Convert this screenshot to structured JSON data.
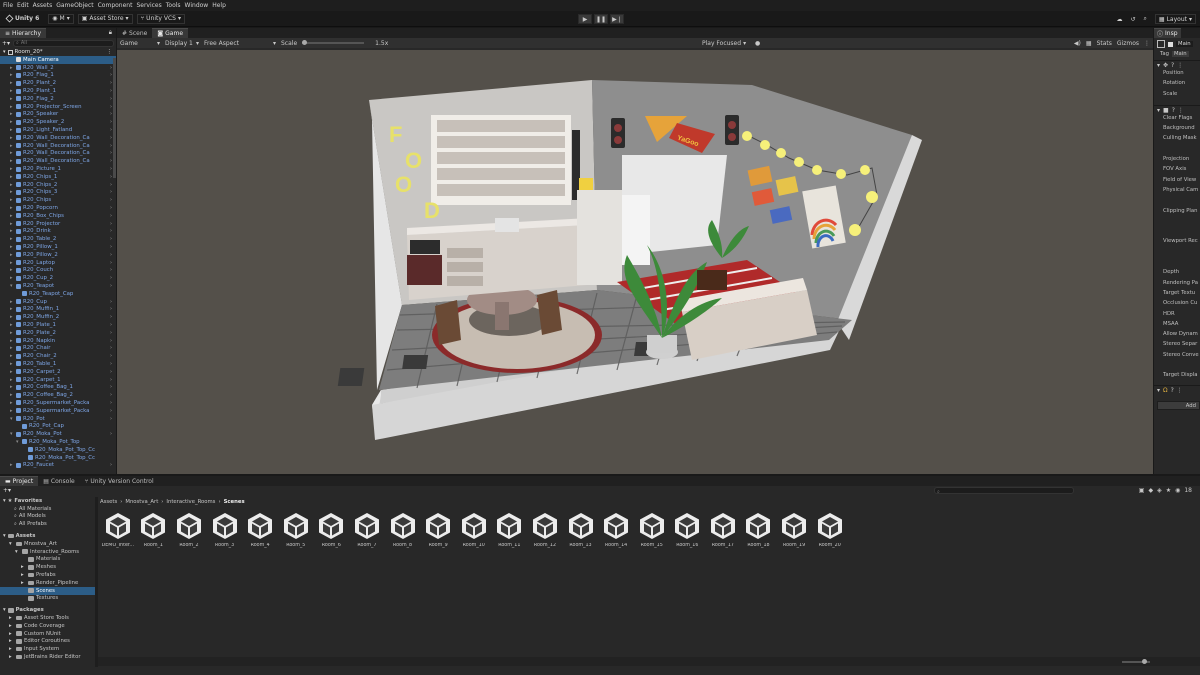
{
  "menubar": [
    "File",
    "Edit",
    "Assets",
    "GameObject",
    "Component",
    "Services",
    "Tools",
    "Window",
    "Help"
  ],
  "toolbar": {
    "unity_version": "Unity 6",
    "account": "M",
    "asset_store": "Asset Store",
    "vcs": "Unity VCS",
    "layout": "Layout"
  },
  "hierarchy": {
    "tab": "Hierarchy",
    "search_placeholder": "All",
    "scene": "Room_20*",
    "items": [
      {
        "label": "Main Camera",
        "indent": 1,
        "arrow": false,
        "selected": true
      },
      {
        "label": "R20_Wall_2",
        "indent": 1,
        "arrow": true
      },
      {
        "label": "R20_Flag_1",
        "indent": 1,
        "arrow": true
      },
      {
        "label": "R20_Plant_2",
        "indent": 1,
        "arrow": true
      },
      {
        "label": "R20_Plant_1",
        "indent": 1,
        "arrow": true
      },
      {
        "label": "R20_Flag_2",
        "indent": 1,
        "arrow": true
      },
      {
        "label": "R20_Projector_Screen",
        "indent": 1,
        "arrow": true
      },
      {
        "label": "R20_Speaker",
        "indent": 1,
        "arrow": true
      },
      {
        "label": "R20_Speaker_2",
        "indent": 1,
        "arrow": true
      },
      {
        "label": "R20_Light_Fatland",
        "indent": 1,
        "arrow": true
      },
      {
        "label": "R20_Wall_Decoration_Ca",
        "indent": 1,
        "arrow": true
      },
      {
        "label": "R20_Wall_Decoration_Ca",
        "indent": 1,
        "arrow": true
      },
      {
        "label": "R20_Wall_Decoration_Ca",
        "indent": 1,
        "arrow": true
      },
      {
        "label": "R20_Wall_Decoration_Ca",
        "indent": 1,
        "arrow": true
      },
      {
        "label": "R20_Picture_1",
        "indent": 1,
        "arrow": true
      },
      {
        "label": "R20_Chips_1",
        "indent": 1,
        "arrow": true
      },
      {
        "label": "R20_Chips_2",
        "indent": 1,
        "arrow": true
      },
      {
        "label": "R20_Chips_3",
        "indent": 1,
        "arrow": true
      },
      {
        "label": "R20_Chips",
        "indent": 1,
        "arrow": true
      },
      {
        "label": "R20_Popcorn",
        "indent": 1,
        "arrow": true
      },
      {
        "label": "R20_Box_Chips",
        "indent": 1,
        "arrow": true
      },
      {
        "label": "R20_Projector",
        "indent": 1,
        "arrow": true
      },
      {
        "label": "R20_Drink",
        "indent": 1,
        "arrow": true
      },
      {
        "label": "R20_Table_2",
        "indent": 1,
        "arrow": true
      },
      {
        "label": "R20_Pillow_1",
        "indent": 1,
        "arrow": true
      },
      {
        "label": "R20_Pillow_2",
        "indent": 1,
        "arrow": true
      },
      {
        "label": "R20_Laptop",
        "indent": 1,
        "arrow": true
      },
      {
        "label": "R20_Couch",
        "indent": 1,
        "arrow": true
      },
      {
        "label": "R20_Cup_2",
        "indent": 1,
        "arrow": true
      },
      {
        "label": "R20_Teapot",
        "indent": 1,
        "arrow": true,
        "expanded": true
      },
      {
        "label": "R20_Teapot_Cap",
        "indent": 2,
        "arrow": false
      },
      {
        "label": "R20_Cup",
        "indent": 1,
        "arrow": true
      },
      {
        "label": "R20_Muffin_1",
        "indent": 1,
        "arrow": true
      },
      {
        "label": "R20_Muffin_2",
        "indent": 1,
        "arrow": true
      },
      {
        "label": "R20_Plate_1",
        "indent": 1,
        "arrow": true
      },
      {
        "label": "R20_Plate_2",
        "indent": 1,
        "arrow": true
      },
      {
        "label": "R20_Napkin",
        "indent": 1,
        "arrow": true
      },
      {
        "label": "R20_Chair",
        "indent": 1,
        "arrow": true
      },
      {
        "label": "R20_Chair_2",
        "indent": 1,
        "arrow": true
      },
      {
        "label": "R20_Table_1",
        "indent": 1,
        "arrow": true
      },
      {
        "label": "R20_Carpet_2",
        "indent": 1,
        "arrow": true
      },
      {
        "label": "R20_Carpet_1",
        "indent": 1,
        "arrow": true
      },
      {
        "label": "R20_Coffee_Bag_1",
        "indent": 1,
        "arrow": true
      },
      {
        "label": "R20_Coffee_Bag_2",
        "indent": 1,
        "arrow": true
      },
      {
        "label": "R20_Supermarket_Packa",
        "indent": 1,
        "arrow": true
      },
      {
        "label": "R20_Supermarket_Packa",
        "indent": 1,
        "arrow": true
      },
      {
        "label": "R20_Pot",
        "indent": 1,
        "arrow": true,
        "expanded": true
      },
      {
        "label": "R20_Pot_Cap",
        "indent": 2,
        "arrow": false
      },
      {
        "label": "R20_Moka_Pot",
        "indent": 1,
        "arrow": true,
        "expanded": true
      },
      {
        "label": "R20_Moka_Pot_Top",
        "indent": 2,
        "arrow": true,
        "expanded": true
      },
      {
        "label": "R20_Moka_Pot_Top_Cc",
        "indent": 3,
        "arrow": false
      },
      {
        "label": "R20_Moka_Pot_Top_Cc",
        "indent": 3,
        "arrow": false
      },
      {
        "label": "R20_Faucet",
        "indent": 1,
        "arrow": true
      }
    ]
  },
  "view": {
    "tabs": [
      "Scene",
      "Game"
    ],
    "active_tab": "Game",
    "mode": "Game",
    "display": "Display 1",
    "aspect": "Free Aspect",
    "scale_label": "Scale",
    "scale_value": "1.5x",
    "play_focused": "Play Focused",
    "stats": "Stats",
    "gizmos": "Gizmos"
  },
  "scene_text": {
    "food_sign": [
      "F",
      "O",
      "O",
      "D"
    ],
    "pennant": "YaGoo"
  },
  "inspector": {
    "tab": "Insp",
    "name": "Main",
    "tag_label": "Tag",
    "tag_value": "Main",
    "transform_fields": [
      "Position",
      "Rotation",
      "Scale"
    ],
    "camera_fields": [
      "Clear Flags",
      "Background",
      "Culling Mask",
      "",
      "Projection",
      "FOV Axis",
      "Field of View",
      "Physical Cam",
      "",
      "Clipping Plan",
      "",
      "",
      "Viewport Rec",
      "",
      "",
      "Depth",
      "Rendering Pa",
      "Target Textu",
      "Occlusion Cu",
      "HDR",
      "MSAA",
      "Allow Dynam",
      "Stereo Separ",
      "Stereo Conve",
      "",
      "Target Displa"
    ],
    "add_button": "Add"
  },
  "project": {
    "tabs": [
      "Project",
      "Console",
      "Unity Version Control"
    ],
    "active_tab": "Project",
    "favorites_label": "Favorites",
    "favorites": [
      "All Materials",
      "All Models",
      "All Prefabs"
    ],
    "assets_label": "Assets",
    "tree": [
      {
        "label": "Mnostva_Art",
        "indent": 1,
        "arrow": "down"
      },
      {
        "label": "Interactive_Rooms",
        "indent": 2,
        "arrow": "down"
      },
      {
        "label": "Materials",
        "indent": 3,
        "arrow": ""
      },
      {
        "label": "Meshes",
        "indent": 3,
        "arrow": "right"
      },
      {
        "label": "Prefabs",
        "indent": 3,
        "arrow": "right"
      },
      {
        "label": "Render_Pipeline",
        "indent": 3,
        "arrow": "right"
      },
      {
        "label": "Scenes",
        "indent": 3,
        "arrow": "",
        "selected": true
      },
      {
        "label": "Textures",
        "indent": 3,
        "arrow": ""
      }
    ],
    "packages_label": "Packages",
    "packages": [
      "Asset Store Tools",
      "Code Coverage",
      "Custom NUnit",
      "Editor Coroutines",
      "Input System",
      "JetBrains Rider Editor"
    ],
    "breadcrumb": [
      "Assets",
      "Mnostva_Art",
      "Interactive_Rooms",
      "Scenes"
    ],
    "hidden_count": "18",
    "scenes": [
      "DEMO_Inter...",
      "Room_1",
      "Room_2",
      "Room_3",
      "Room_4",
      "Room_5",
      "Room_6",
      "Room_7",
      "Room_8",
      "Room_9",
      "Room_10",
      "Room_11",
      "Room_12",
      "Room_13",
      "Room_14",
      "Room_15",
      "Room_16",
      "Room_17",
      "Room_18",
      "Room_19",
      "Room_20"
    ]
  }
}
